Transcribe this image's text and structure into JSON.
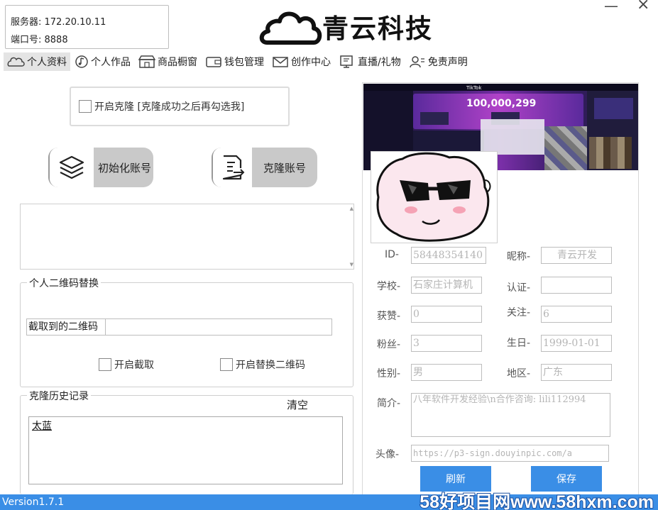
{
  "server": {
    "host_label": "服务器: 172.20.10.11",
    "port_label": "端口号: 8888"
  },
  "logo": {
    "text": "青云科技"
  },
  "window": {
    "minimize": "—",
    "close": "×"
  },
  "tabs": [
    {
      "label": "个人资料",
      "icon": "cloud-icon",
      "active": true
    },
    {
      "label": "个人作品",
      "icon": "music-note-icon",
      "active": false
    },
    {
      "label": "商品橱窗",
      "icon": "shop-icon",
      "active": false
    },
    {
      "label": "钱包管理",
      "icon": "wallet-icon",
      "active": false
    },
    {
      "label": "创作中心",
      "icon": "mail-icon",
      "active": false
    },
    {
      "label": "直播/礼物",
      "icon": "live-icon",
      "active": false
    },
    {
      "label": "免责声明",
      "icon": "disclaimer-icon",
      "active": false
    }
  ],
  "clone": {
    "checkbox_label": "开启克隆 [克隆成功之后再勾选我]",
    "init_button": "初始化账号",
    "clone_button": "克隆账号",
    "init_icon": "layers-icon",
    "clone_icon": "document-export-icon"
  },
  "qr": {
    "group_title": "个人二维码替换",
    "capture_label": "截取到的二维码",
    "capture_value": "",
    "enable_capture": "开启截取",
    "enable_replace": "开启替换二维码"
  },
  "history": {
    "group_title": "克隆历史记录",
    "clear": "清空",
    "items": [
      "太蓝"
    ]
  },
  "profile": {
    "banner_text": "100,000,299",
    "banner_brand": "TikTok",
    "id_label": "ID-",
    "id_value": "58448354140",
    "nickname_label": "昵称-",
    "nickname_value": "青云开发",
    "school_label": "学校-",
    "school_value": "石家庄计算机",
    "cert_label": "认证-",
    "cert_value": "",
    "likes_label": "获赞-",
    "likes_value": "0",
    "follow_label": "关注-",
    "follow_value": "6",
    "fans_label": "粉丝-",
    "fans_value": "3",
    "birthday_label": "生日-",
    "birthday_value": "1999-01-01",
    "gender_label": "性别-",
    "gender_value": "男",
    "region_label": "地区-",
    "region_value": "广东",
    "bio_label": "简介-",
    "bio_value": "八年软件开发经验\\n合作咨询: lili112994",
    "avatar_label": "头像-",
    "avatar_value": "https://p3-sign.douyinpic.com/a",
    "refresh_button": "刷新",
    "save_button": "保存"
  },
  "status": {
    "version": "Version1.7.1",
    "watermark": "58好项目网www.58hxm.com"
  },
  "colors": {
    "accent": "#3a8ee6",
    "pill_gray": "#c9c9c9",
    "input_text": "#b5b5b5"
  }
}
